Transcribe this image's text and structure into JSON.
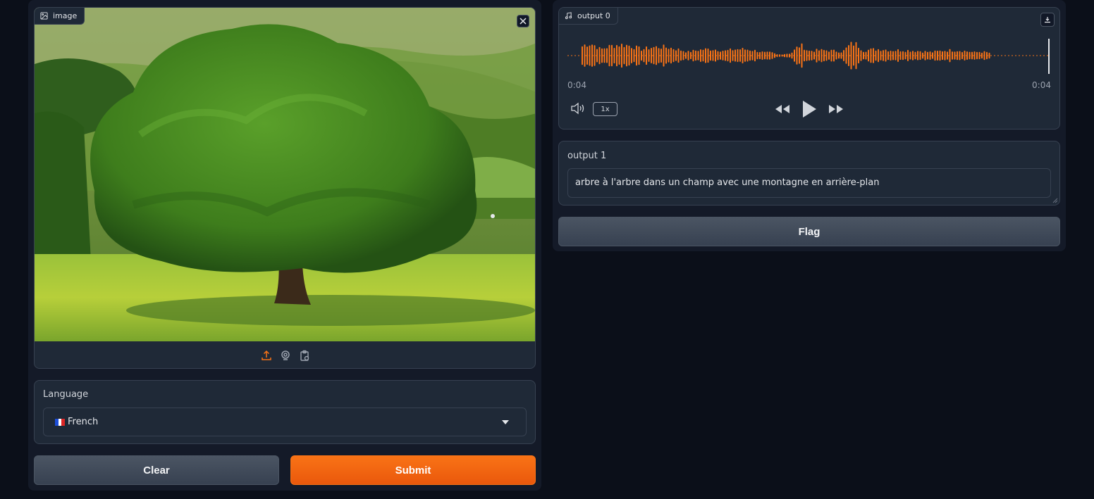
{
  "image_input": {
    "label": "image",
    "icon": "image-icon",
    "toolbar": [
      "upload-icon",
      "webcam-icon",
      "clipboard-icon"
    ]
  },
  "language": {
    "label": "Language",
    "selected": "French",
    "flag": "🇫🇷"
  },
  "buttons": {
    "clear": "Clear",
    "submit": "Submit",
    "flag": "Flag"
  },
  "audio_output": {
    "label": "output 0",
    "icon": "music-note-icon",
    "current_time": "0:04",
    "duration": "0:04",
    "playback_rate": "1x",
    "progress": 1.0
  },
  "text_output": {
    "label": "output 1",
    "value": "arbre à l'arbre dans un champ avec une montagne en arrière-plan"
  },
  "colors": {
    "accent": "#f97316",
    "background": "#0b0f19",
    "panel": "#1f2937",
    "waveform": "#f97316"
  }
}
